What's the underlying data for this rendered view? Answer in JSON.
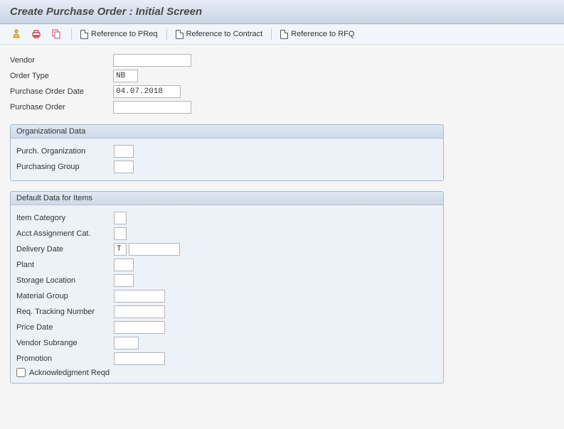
{
  "title": "Create Purchase Order : Initial Screen",
  "toolbar": {
    "ref_preq": "Reference to PReq",
    "ref_contract": "Reference to Contract",
    "ref_rfq": "Reference to RFQ"
  },
  "header": {
    "vendor_label": "Vendor",
    "vendor_value": "",
    "order_type_label": "Order Type",
    "order_type_value": "NB",
    "po_date_label": "Purchase Order Date",
    "po_date_value": "04.07.2018",
    "po_label": "Purchase Order",
    "po_value": ""
  },
  "org": {
    "group_title": "Organizational Data",
    "purch_org_label": "Purch. Organization",
    "purch_org_value": "",
    "purch_grp_label": "Purchasing Group",
    "purch_grp_value": ""
  },
  "defaults": {
    "group_title": "Default Data for Items",
    "item_cat_label": "Item Category",
    "item_cat_value": "",
    "acct_assign_label": "Acct Assignment Cat.",
    "acct_assign_value": "",
    "delivery_date_label": "Delivery Date",
    "delivery_date_type": "T",
    "delivery_date_value": "",
    "plant_label": "Plant",
    "plant_value": "",
    "storage_loc_label": "Storage Location",
    "storage_loc_value": "",
    "material_grp_label": "Material Group",
    "material_grp_value": "",
    "req_track_label": "Req. Tracking Number",
    "req_track_value": "",
    "price_date_label": "Price Date",
    "price_date_value": "",
    "vendor_subrange_label": "Vendor Subrange",
    "vendor_subrange_value": "",
    "promotion_label": "Promotion",
    "promotion_value": "",
    "ack_reqd_label": "Acknowledgment Reqd",
    "ack_reqd_checked": false
  }
}
